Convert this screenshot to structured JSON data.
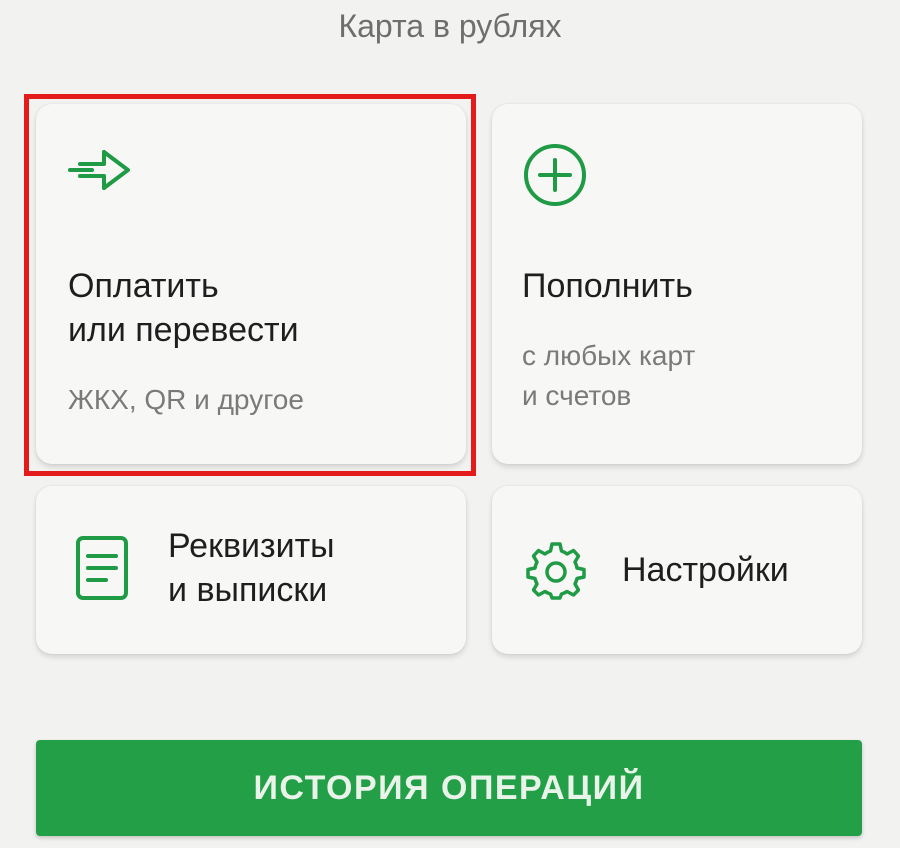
{
  "header": {
    "title": "Карта в рублях"
  },
  "cards": {
    "pay": {
      "title_line1": "Оплатить",
      "title_line2": "или перевести",
      "subtitle": "ЖКХ, QR и другое",
      "icon": "send-arrow-icon"
    },
    "topup": {
      "title": "Пополнить",
      "subtitle_line1": "с любых карт",
      "subtitle_line2": "и счетов",
      "icon": "plus-circle-icon"
    },
    "requisites": {
      "title_line1": "Реквизиты",
      "title_line2": "и выписки",
      "icon": "document-icon"
    },
    "settings": {
      "title": "Настройки",
      "icon": "gear-icon"
    }
  },
  "history_button": {
    "label": "ИСТОРИЯ ОПЕРАЦИЙ"
  },
  "colors": {
    "accent": "#23a047",
    "icon_green": "#1f9a45",
    "highlight": "#e41b1b",
    "background": "#f2f3f1"
  }
}
